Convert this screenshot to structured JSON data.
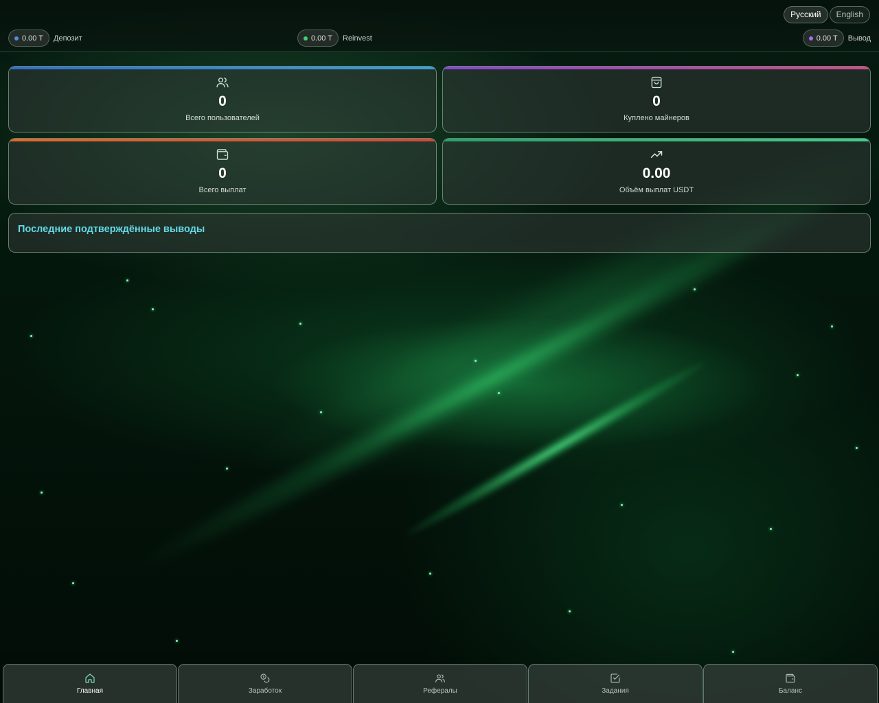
{
  "languages": [
    {
      "label": "Русский",
      "active": true
    },
    {
      "label": "English",
      "active": false
    }
  ],
  "balances": {
    "deposit": {
      "amount": "0.00 T",
      "label": "Депозит",
      "dot_color": "#4f8ee6"
    },
    "reinvest": {
      "amount": "0.00 T",
      "label": "Reinvest",
      "dot_color": "#3fd46f"
    },
    "withdraw": {
      "amount": "0.00 T",
      "label": "Вывод",
      "dot_color": "#a66ff0"
    }
  },
  "stats": [
    {
      "icon": "users-icon",
      "value": "0",
      "label": "Всего пользователей",
      "accent": "#3b82d6"
    },
    {
      "icon": "shopping-bag-icon",
      "value": "0",
      "label": "Куплено майнеров",
      "accent": "#b04fd9"
    },
    {
      "icon": "wallet-icon",
      "value": "0",
      "label": "Всего выплат",
      "accent": "#e0682c"
    },
    {
      "icon": "trending-up-icon",
      "value": "0.00",
      "label": "Объём выплат USDT",
      "accent": "#2fbf7a"
    }
  ],
  "recent_withdrawals": {
    "title": "Последние подтверждённые выводы"
  },
  "nav": [
    {
      "icon": "home-icon",
      "label": "Главная",
      "active": true
    },
    {
      "icon": "coins-icon",
      "label": "Заработок",
      "active": false
    },
    {
      "icon": "users-icon",
      "label": "Рефералы",
      "active": false
    },
    {
      "icon": "checkbox-icon",
      "label": "Задания",
      "active": false
    },
    {
      "icon": "wallet-icon",
      "label": "Баланс",
      "active": false
    }
  ]
}
